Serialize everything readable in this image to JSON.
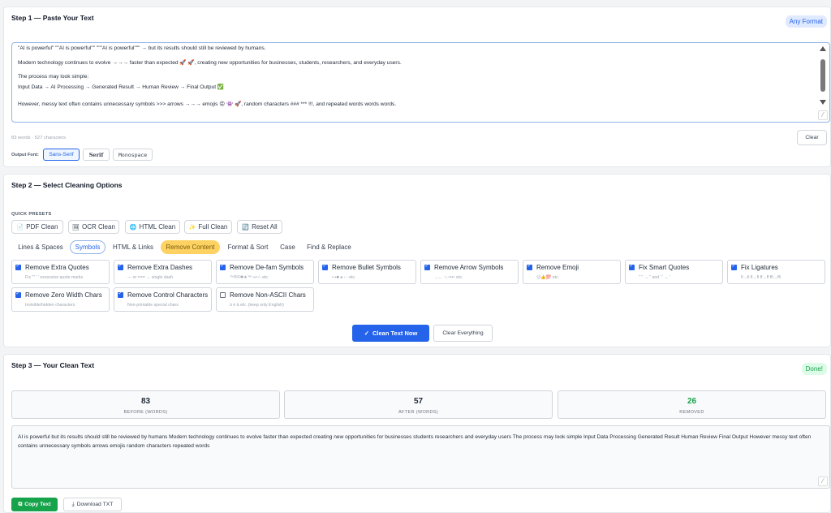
{
  "step1": {
    "title": "Step 1 — Paste Your Text",
    "badge": "Any Format",
    "input_lines": [
      "\"AI is powerful\" \"\"AI is powerful\"\" \"\"\"AI is powerful\"\"\" → but its results should still be reviewed by humans.",
      "Modern technology continues to evolve →→→ faster than expected 🚀 🚀, creating new opportunities for businesses, students, researchers, and everyday users.",
      "The process may look simple:",
      "Input Data → AI Processing → Generated Result → Human Review → Final Output ✅",
      "However, messy text often contains unnecessary symbols >>> arrows →→→ emojis 😡 👾 🚀, random characters ### *** !!!, and repeated words words words."
    ],
    "counter": "83 words · 527 characters",
    "clear_label": "Clear",
    "font_label": "Output Font:",
    "fonts": [
      "Sans-Serif",
      "Serif",
      "Monospace"
    ]
  },
  "step2": {
    "title": "Step 2 — Select Cleaning Options",
    "presets_label": "QUICK PRESETS",
    "presets": [
      {
        "icon": "📄",
        "label": "PDF Clean"
      },
      {
        "icon": "🖼",
        "label": "OCR Clean"
      },
      {
        "icon": "🌐",
        "label": "HTML Clean"
      },
      {
        "icon": "✨",
        "label": "Full Clean"
      },
      {
        "icon": "🔄",
        "label": "Reset All"
      }
    ],
    "tabs": [
      "Lines & Spaces",
      "Symbols",
      "HTML & Links",
      "Remove Content",
      "Format & Sort",
      "Case",
      "Find & Replace"
    ],
    "options": [
      {
        "label": "Remove Extra Quotes",
        "desc": "Fix \"\" ' ' excessive quote marks",
        "checked": true
      },
      {
        "label": "Remove Extra Dashes",
        "desc": "--- or === → single dash",
        "checked": true
      },
      {
        "label": "Remove De-fam Symbols",
        "desc": "™®©✱★™ ∞•☆ etc.",
        "checked": true
      },
      {
        "label": "Remove Bullet Symbols",
        "desc": "•◦▪■ ● ◦ ◦ etc.",
        "checked": true
      },
      {
        "label": "Remove Arrow Symbols",
        "desc": "→← ↑↓⇒⇐ etc.",
        "checked": true
      },
      {
        "label": "Remove Emoji",
        "desc": "😊👍💯 etc.",
        "checked": true
      },
      {
        "label": "Fix Smart Quotes",
        "desc": "\" \" → \" and ' ' → '",
        "checked": true
      },
      {
        "label": "Fix Ligatures",
        "desc": "fi→fi fl→fl ff→ff ffi→ffi",
        "checked": true
      },
      {
        "label": "Remove Zero Width Chars",
        "desc": "Invisible/hidden characters",
        "checked": true
      },
      {
        "label": "Remove Control Characters",
        "desc": "Non-printable special chars",
        "checked": true
      },
      {
        "label": "Remove Non-ASCII Chars",
        "desc": "ü é ä etc. (keep only English)",
        "checked": false
      }
    ],
    "clean_label": "Clean Text Now",
    "clear_all_label": "Clear Everything"
  },
  "step3": {
    "title": "Step 3 — Your Clean Text",
    "badge": "Done!",
    "stats": [
      {
        "value": "83",
        "label": "BEFORE (WORDS)"
      },
      {
        "value": "57",
        "label": "AFTER (WORDS)"
      },
      {
        "value": "26",
        "label": "REMOVED"
      }
    ],
    "output": "AI is powerful but its results should still be reviewed by humans Modern technology continues to evolve faster than expected creating new opportunities for businesses students researchers and everyday users The process may look simple Input Data Processing Generated Result Human Review Final Output However messy text often contains unnecessary symbols arrows emojis random characters repeated words",
    "copy_label": "Copy Text",
    "download_label": "Download TXT"
  }
}
